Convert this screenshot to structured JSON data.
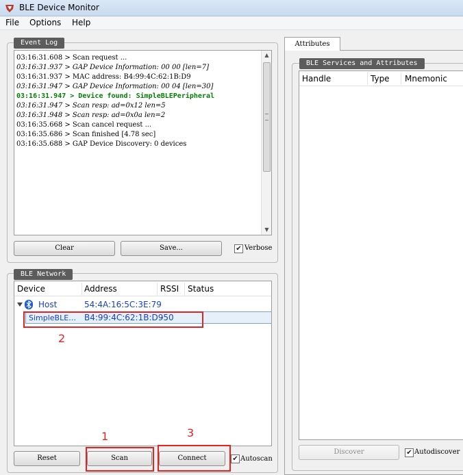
{
  "window": {
    "title": "BLE Device Monitor"
  },
  "menu": [
    "File",
    "Options",
    "Help"
  ],
  "event_log": {
    "title": "Event Log",
    "lines": [
      {
        "text": "03:16:31.608 > Scan request ...",
        "style": "normal"
      },
      {
        "text": "03:16:31.937 > GAP Device Information: 00 00 [len=7]",
        "style": "italic"
      },
      {
        "text": "03:16:31.937 > MAC address: B4:99:4C:62:1B:D9",
        "style": "normal"
      },
      {
        "text": "03:16:31.947 > GAP Device Information: 00 04 [len=30]",
        "style": "italic"
      },
      {
        "text": "03:16:31.947 > Device found: SimpleBLEPeripheral",
        "style": "green"
      },
      {
        "text": "03:16:31.947 > Scan resp: ad=0x12 len=5",
        "style": "italic"
      },
      {
        "text": "03:16:31.948 > Scan resp: ad=0x0a len=2",
        "style": "italic"
      },
      {
        "text": "03:16:35.668 > Scan cancel request ...",
        "style": "normal"
      },
      {
        "text": "03:16:35.686 > Scan finished [4.78 sec]",
        "style": "normal"
      },
      {
        "text": "03:16:35.688 > GAP Device Discovery: 0 devices",
        "style": "normal"
      }
    ],
    "clear_label": "Clear",
    "save_label": "Save...",
    "verbose_label": "Verbose",
    "verbose_checked": true
  },
  "ble_network": {
    "title": "BLE Network",
    "columns": [
      "Device",
      "Address",
      "RSSI",
      "Status"
    ],
    "host": {
      "name": "Host",
      "address": "54:4A:16:5C:3E:79"
    },
    "device": {
      "name": "SimpleBLE…",
      "address": "B4:99:4C:62:1B:D9",
      "rssi": "-50"
    },
    "reset_label": "Reset",
    "scan_label": "Scan",
    "connect_label": "Connect",
    "autoscan_label": "Autoscan",
    "autoscan_checked": true
  },
  "annotations": [
    "1",
    "2",
    "3"
  ],
  "attributes": {
    "tab_label": "Attributes",
    "group_title": "BLE Services and Attributes",
    "columns": [
      "Handle",
      "Type",
      "Mnemonic"
    ],
    "discover_label": "Discover",
    "autodiscover_label": "Autodiscover",
    "autodiscover_checked": true
  },
  "colors": {
    "annotation": "#e52222",
    "device_text": "#1a3fc8",
    "log_highlight": "#008000"
  }
}
